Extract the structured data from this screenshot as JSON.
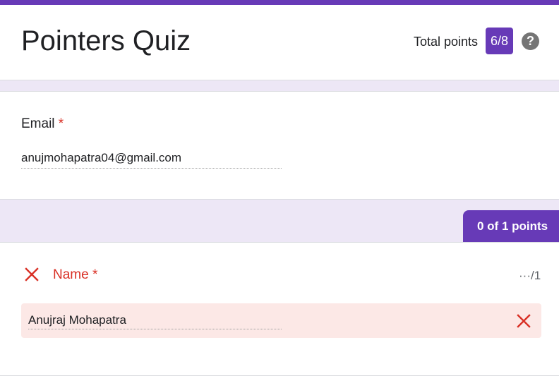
{
  "form": {
    "title": "Pointers Quiz",
    "total_points_label": "Total points",
    "total_score": "6/8",
    "help_icon": "help-circle-icon",
    "accent_color": "#673ab7"
  },
  "email_question": {
    "label": "Email",
    "required_marker": "*",
    "value": "anujmohapatra04@gmail.com"
  },
  "name_question": {
    "points_badge": "0 of 1 points",
    "status_icon": "wrong-x-icon",
    "label": "Name",
    "required_marker": "*",
    "score_placeholder": "···",
    "score_max": "/1",
    "answer": "Anujraj Mohapatra",
    "answer_status_icon": "wrong-x-icon",
    "error_color": "#d93025"
  }
}
